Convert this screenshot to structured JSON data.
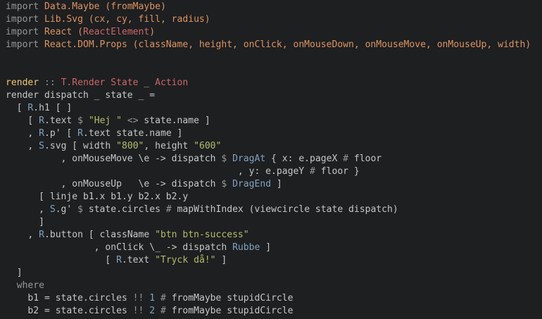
{
  "colors": {
    "background": "#1d1f21",
    "plain": "#c5c8c6",
    "keyword": "#969896",
    "module": "#de935f",
    "type": "#cc6666",
    "string": "#b5bd68",
    "qualifier": "#81a2be",
    "operator": "#969896",
    "number": "#81a2be",
    "function_def": "#f0c674",
    "underscore": "#b5bd68"
  },
  "code_lines": [
    [
      [
        "keyword",
        "import "
      ],
      [
        "module",
        "Data.Maybe"
      ],
      [
        "plain",
        " "
      ],
      [
        "module",
        "(fromMaybe)"
      ]
    ],
    [
      [
        "keyword",
        "import "
      ],
      [
        "module",
        "Lib.Svg"
      ],
      [
        "plain",
        " "
      ],
      [
        "module",
        "(cx, cy, fill, radius)"
      ]
    ],
    [
      [
        "keyword",
        "import "
      ],
      [
        "module",
        "React"
      ],
      [
        "plain",
        " "
      ],
      [
        "module",
        "("
      ],
      [
        "type",
        "ReactElement"
      ],
      [
        "module",
        ")"
      ]
    ],
    [
      [
        "keyword",
        "import "
      ],
      [
        "module",
        "React.DOM.Props"
      ],
      [
        "plain",
        " "
      ],
      [
        "module",
        "(className, height, onClick, onMouseDown, onMouseMove, onMouseUp, width)"
      ]
    ],
    [],
    [],
    [
      [
        "function_def",
        "render"
      ],
      [
        "operator",
        " :: "
      ],
      [
        "type",
        "T.Render State "
      ],
      [
        "underscore",
        "_"
      ],
      [
        "type",
        " Action"
      ]
    ],
    [
      [
        "plain",
        "render dispatch _ state _ ="
      ]
    ],
    [
      [
        "plain",
        "  [ "
      ],
      [
        "qualifier",
        "R"
      ],
      [
        "plain",
        ".h1 [ ]"
      ]
    ],
    [
      [
        "plain",
        "    [ "
      ],
      [
        "qualifier",
        "R"
      ],
      [
        "plain",
        ".text "
      ],
      [
        "operator",
        "$ "
      ],
      [
        "string",
        "\"Hej \""
      ],
      [
        "operator",
        " <> "
      ],
      [
        "plain",
        "state.name ]"
      ]
    ],
    [
      [
        "plain",
        "    , "
      ],
      [
        "qualifier",
        "R"
      ],
      [
        "plain",
        ".p' [ "
      ],
      [
        "qualifier",
        "R"
      ],
      [
        "plain",
        ".text state.name ]"
      ]
    ],
    [
      [
        "plain",
        "    , "
      ],
      [
        "qualifier",
        "S"
      ],
      [
        "plain",
        ".svg [ width "
      ],
      [
        "string",
        "\"800\""
      ],
      [
        "plain",
        ", height "
      ],
      [
        "string",
        "\"600\""
      ]
    ],
    [
      [
        "plain",
        "          , onMouseMove \\e -> dispatch "
      ],
      [
        "operator",
        "$ "
      ],
      [
        "qualifier",
        "DragAt"
      ],
      [
        "plain",
        " { x: e.pageX "
      ],
      [
        "operator",
        "# "
      ],
      [
        "plain",
        "floor"
      ]
    ],
    [
      [
        "plain",
        "                                          , y: e.pageY "
      ],
      [
        "operator",
        "# "
      ],
      [
        "plain",
        "floor }"
      ]
    ],
    [
      [
        "plain",
        "          , onMouseUp   \\e -> dispatch "
      ],
      [
        "operator",
        "$ "
      ],
      [
        "qualifier",
        "DragEnd"
      ],
      [
        "plain",
        " ]"
      ]
    ],
    [
      [
        "plain",
        "      [ linje b1.x b1.y b2.x b2.y"
      ]
    ],
    [
      [
        "plain",
        "      , "
      ],
      [
        "qualifier",
        "S"
      ],
      [
        "plain",
        ".g' "
      ],
      [
        "operator",
        "$ "
      ],
      [
        "plain",
        "state.circles "
      ],
      [
        "operator",
        "# "
      ],
      [
        "plain",
        "mapWithIndex (viewcircle state dispatch)"
      ]
    ],
    [
      [
        "plain",
        "      ]"
      ]
    ],
    [
      [
        "plain",
        "    , "
      ],
      [
        "qualifier",
        "R"
      ],
      [
        "plain",
        ".button [ className "
      ],
      [
        "string",
        "\"btn btn-success\""
      ]
    ],
    [
      [
        "plain",
        "                , onClick \\_ -> dispatch "
      ],
      [
        "qualifier",
        "Rubbe"
      ],
      [
        "plain",
        " ]"
      ]
    ],
    [
      [
        "plain",
        "                  [ "
      ],
      [
        "qualifier",
        "R"
      ],
      [
        "plain",
        ".text "
      ],
      [
        "string",
        "\"Tryck då!\""
      ],
      [
        "plain",
        " ]"
      ]
    ],
    [
      [
        "plain",
        "  ]"
      ]
    ],
    [
      [
        "keyword",
        "  where"
      ]
    ],
    [
      [
        "plain",
        "    b1 = state.circles "
      ],
      [
        "operator",
        "!! "
      ],
      [
        "number",
        "1"
      ],
      [
        "plain",
        " "
      ],
      [
        "operator",
        "# "
      ],
      [
        "plain",
        "fromMaybe stupidCircle"
      ]
    ],
    [
      [
        "plain",
        "    b2 = state.circles "
      ],
      [
        "operator",
        "!! "
      ],
      [
        "number",
        "2"
      ],
      [
        "plain",
        " "
      ],
      [
        "operator",
        "# "
      ],
      [
        "plain",
        "fromMaybe stupidCircle"
      ]
    ]
  ]
}
